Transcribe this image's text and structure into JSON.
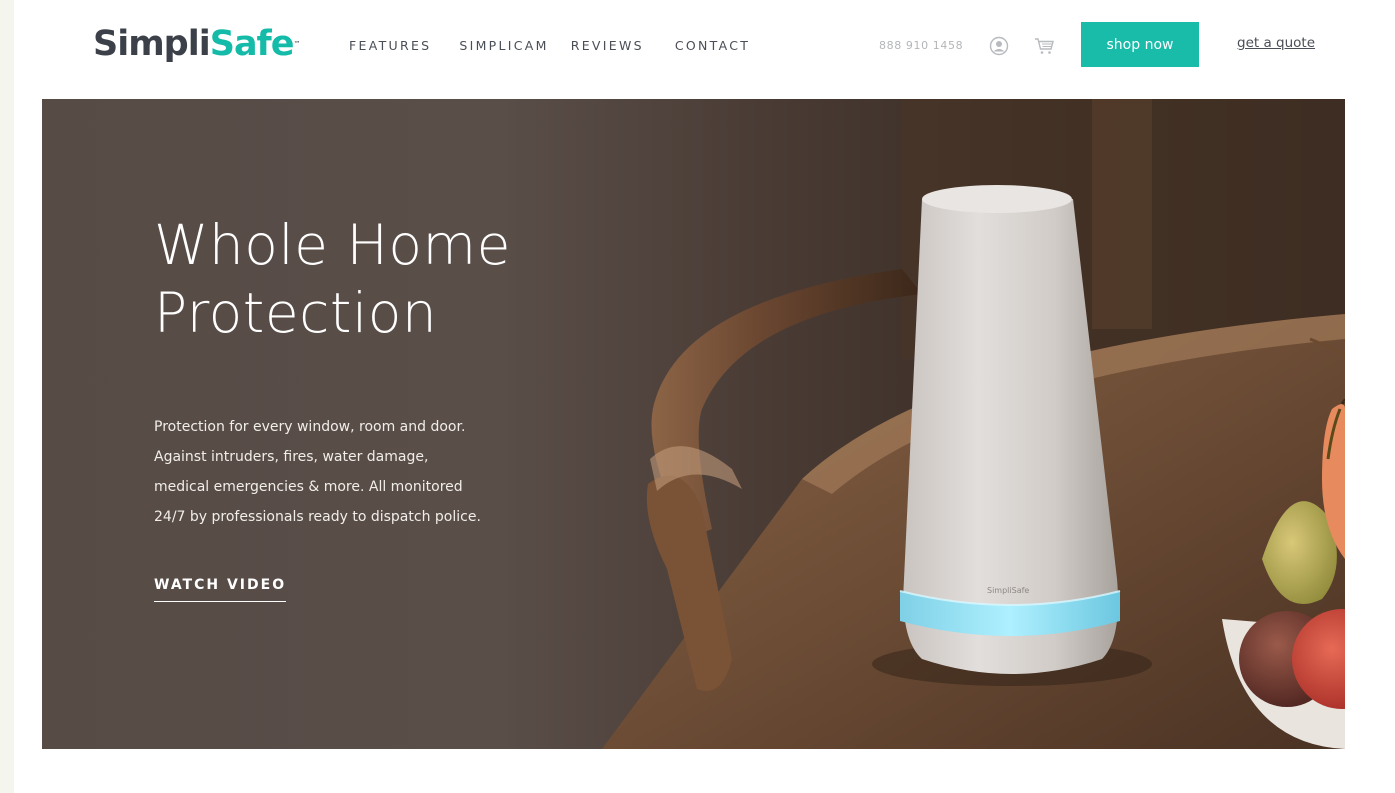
{
  "brand": {
    "name_part1": "Simpli",
    "name_part2": "Safe",
    "trademark": "™",
    "color_dark": "#3b4049",
    "color_accent": "#14bba8"
  },
  "nav": {
    "items": [
      {
        "label": "FEATURES"
      },
      {
        "label": "SIMPLICAM"
      },
      {
        "label": "REVIEWS"
      },
      {
        "label": "CONTACT"
      }
    ]
  },
  "header": {
    "phone": "888 910 1458",
    "account_icon": "user-circle-icon",
    "cart_icon": "shopping-cart-icon",
    "shop_button": "shop now",
    "quote_link": "get a quote"
  },
  "hero": {
    "title_line1": "Whole Home",
    "title_line2": "Protection",
    "body_lines": [
      "Protection for every window, room and door.",
      "Against intruders, fires, water damage,",
      "medical emergencies & more. All monitored",
      "24/7 by professionals ready to dispatch police."
    ],
    "cta": "WATCH VIDEO",
    "device_label": "SimpliSafe"
  }
}
